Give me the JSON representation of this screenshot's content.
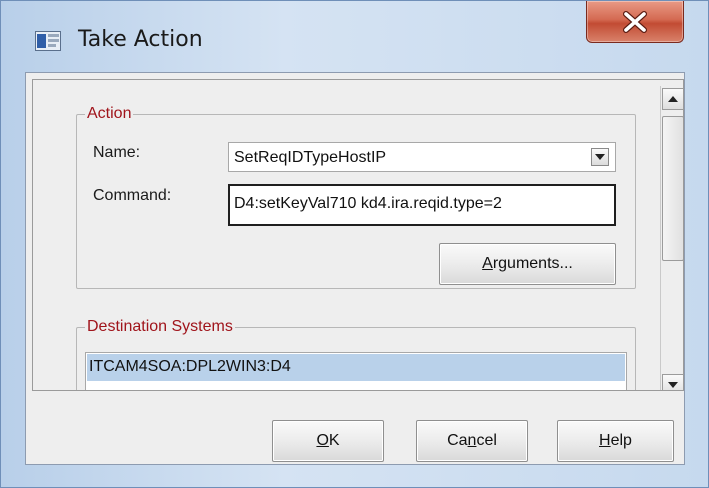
{
  "window": {
    "title": "Take Action",
    "close_glyph": "X",
    "app_icon": "dialog-icon"
  },
  "action": {
    "legend": "Action",
    "name_label": "Name:",
    "name_value": "SetReqIDTypeHostIP",
    "command_label": "Command:",
    "command_value": "D4:setKeyVal710 kd4.ira.reqid.type=2",
    "arguments_button": {
      "pre": "",
      "mnemonic": "A",
      "post": "rguments..."
    }
  },
  "destination": {
    "legend": "Destination Systems",
    "items": [
      "ITCAM4SOA:DPL2WIN3:D4"
    ]
  },
  "footer": {
    "ok": {
      "pre": "",
      "mnemonic": "O",
      "post": "K"
    },
    "cancel": {
      "pre": "Ca",
      "mnemonic": "n",
      "post": "cel"
    },
    "help": {
      "pre": "",
      "mnemonic": "H",
      "post": "elp"
    }
  },
  "colors": {
    "legend": "#a0141b",
    "selection": "#b9d1ea",
    "close_button": "#c24b33"
  }
}
